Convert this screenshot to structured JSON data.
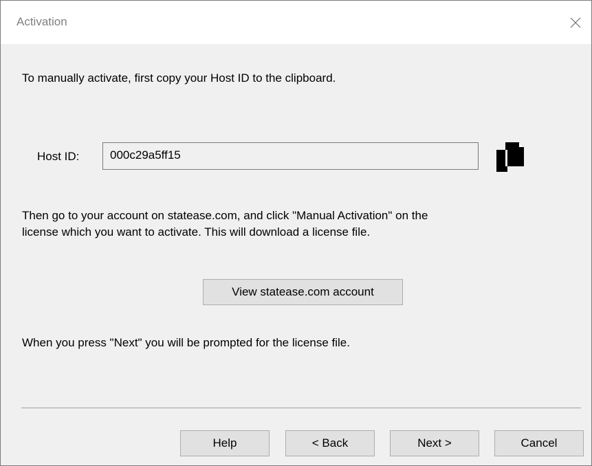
{
  "window": {
    "title": "Activation",
    "close_icon": "close-icon"
  },
  "content": {
    "intro_text": "To manually activate, first copy your Host ID to the clipboard.",
    "host_id_label": "Host ID:",
    "host_id_value": "000c29a5ff15",
    "copy_icon": "copy-icon",
    "instructions_line1": "Then go to your account on statease.com, and click \"Manual Activation\" on the",
    "instructions_line2": "license which you want to activate. This will download a license file.",
    "view_account_label": "View statease.com account",
    "next_prompt_text": "When you press \"Next\" you will be prompted for the license file."
  },
  "footer": {
    "help_label": "Help",
    "back_label": "< Back",
    "next_label": "Next >",
    "cancel_label": "Cancel"
  }
}
